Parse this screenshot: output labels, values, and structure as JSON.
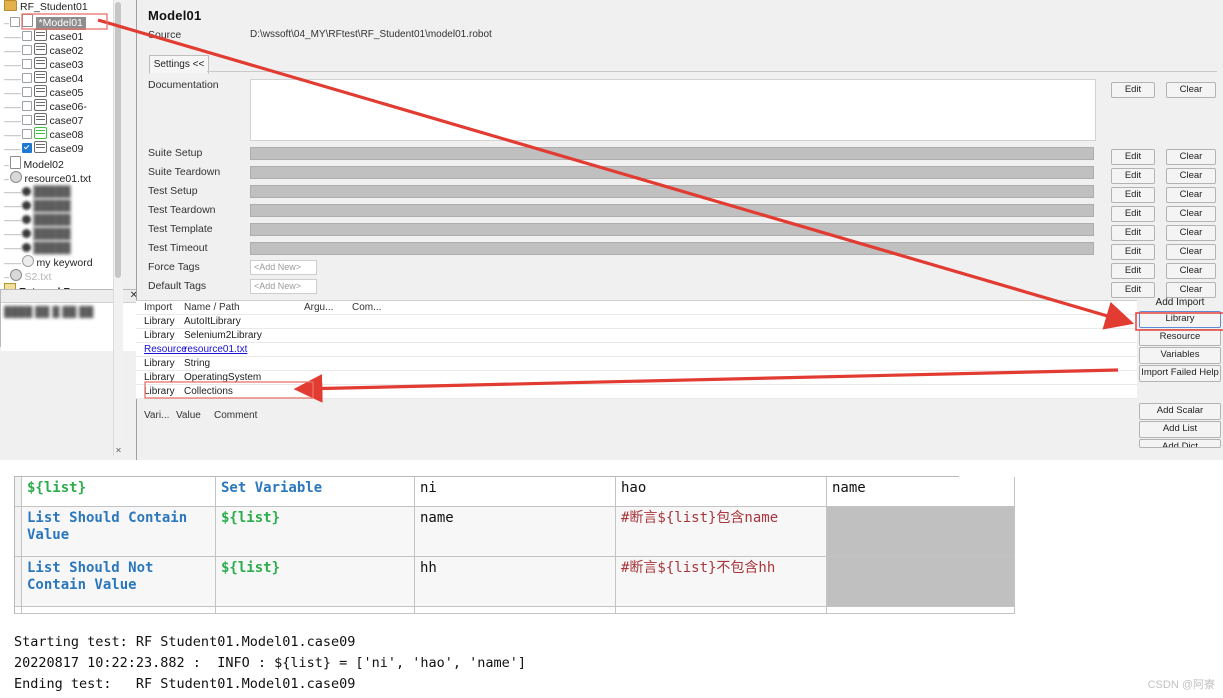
{
  "tree": {
    "items": [
      {
        "label": "RF_Student01",
        "icon": "folder-icon",
        "depth": 0,
        "state": "partial",
        "kind": "folder"
      },
      {
        "label": "*Model01",
        "icon": "file-icon",
        "depth": 1,
        "state": "unchecked",
        "kind": "selected"
      },
      {
        "label": "case01",
        "icon": "testcase-icon",
        "depth": 2,
        "state": "unchecked",
        "kind": "case"
      },
      {
        "label": "case02",
        "icon": "testcase-icon",
        "depth": 2,
        "state": "unchecked",
        "kind": "case"
      },
      {
        "label": "case03",
        "icon": "testcase-icon",
        "depth": 2,
        "state": "unchecked",
        "kind": "case"
      },
      {
        "label": "case04",
        "icon": "testcase-icon",
        "depth": 2,
        "state": "unchecked",
        "kind": "case"
      },
      {
        "label": "case05",
        "icon": "testcase-icon",
        "depth": 2,
        "state": "unchecked",
        "kind": "case"
      },
      {
        "label": "case06-",
        "icon": "testcase-icon",
        "depth": 2,
        "state": "unchecked",
        "kind": "case"
      },
      {
        "label": "case07",
        "icon": "testcase-icon",
        "depth": 2,
        "state": "unchecked",
        "kind": "case"
      },
      {
        "label": "case08",
        "icon": "testcase-icon-green",
        "depth": 2,
        "state": "unchecked",
        "kind": "case-green"
      },
      {
        "label": "case09",
        "icon": "testcase-icon",
        "depth": 2,
        "state": "checked",
        "kind": "case"
      },
      {
        "label": "Model02",
        "icon": "file-icon",
        "depth": 1,
        "state": "none",
        "kind": "file"
      },
      {
        "label": "resource01.txt",
        "icon": "resource-icon",
        "depth": 1,
        "state": "none",
        "kind": "resource"
      },
      {
        "label": "blurred-item-1",
        "icon": "keyword-icon",
        "depth": 2,
        "state": "none",
        "kind": "blur"
      },
      {
        "label": "blurred-item-2",
        "icon": "keyword-icon",
        "depth": 2,
        "state": "none",
        "kind": "blur"
      },
      {
        "label": "blurred-item-3",
        "icon": "keyword-icon",
        "depth": 2,
        "state": "none",
        "kind": "blur"
      },
      {
        "label": "blurred-item-4",
        "icon": "keyword-icon",
        "depth": 2,
        "state": "none",
        "kind": "blur"
      },
      {
        "label": "blurred-item-5",
        "icon": "keyword-icon",
        "depth": 2,
        "state": "none",
        "kind": "blur"
      },
      {
        "label": "my keyword",
        "icon": "keyword-icon",
        "depth": 2,
        "state": "none",
        "kind": "keyword"
      },
      {
        "label": "S2.txt",
        "icon": "resource-icon",
        "depth": 1,
        "state": "none",
        "kind": "faint"
      },
      {
        "label": "External Resources",
        "icon": "external-resources-icon",
        "depth": 0,
        "state": "none",
        "kind": "external"
      }
    ]
  },
  "editor": {
    "title": "Model01",
    "source_label": "Source",
    "source_value": "D:\\wssoft\\04_MY\\RFtest\\RF_Student01\\model01.robot",
    "settings_tab": "Settings <<",
    "settings_rows": [
      {
        "label": "Documentation",
        "type": "textarea",
        "value": "",
        "edit": "Edit",
        "clear": "Clear"
      },
      {
        "label": "Suite Setup",
        "type": "field",
        "value": "",
        "edit": "Edit",
        "clear": "Clear"
      },
      {
        "label": "Suite Teardown",
        "type": "field",
        "value": "",
        "edit": "Edit",
        "clear": "Clear"
      },
      {
        "label": "Test Setup",
        "type": "field",
        "value": "",
        "edit": "Edit",
        "clear": "Clear"
      },
      {
        "label": "Test Teardown",
        "type": "field",
        "value": "",
        "edit": "Edit",
        "clear": "Clear"
      },
      {
        "label": "Test Template",
        "type": "field",
        "value": "",
        "edit": "Edit",
        "clear": "Clear"
      },
      {
        "label": "Test Timeout",
        "type": "field",
        "value": "",
        "edit": "Edit",
        "clear": "Clear"
      },
      {
        "label": "Force Tags",
        "type": "tag",
        "value": "<Add New>",
        "edit": "Edit",
        "clear": "Clear"
      },
      {
        "label": "Default Tags",
        "type": "tag",
        "value": "<Add New>",
        "edit": "Edit",
        "clear": "Clear"
      }
    ]
  },
  "imports": {
    "headers": [
      "Import",
      "Name / Path",
      "Argu...",
      "Com..."
    ],
    "rows": [
      {
        "type": "Library",
        "name": "AutoItLibrary",
        "link": false,
        "highlight": false
      },
      {
        "type": "Library",
        "name": "Selenium2Library",
        "link": false,
        "highlight": false
      },
      {
        "type": "Resource",
        "name": "resource01.txt",
        "link": true,
        "highlight": false
      },
      {
        "type": "Library",
        "name": "String",
        "link": false,
        "highlight": false
      },
      {
        "type": "Library",
        "name": "OperatingSystem",
        "link": false,
        "highlight": false
      },
      {
        "type": "Library",
        "name": "Collections",
        "link": false,
        "highlight": true
      }
    ],
    "variables_headers": [
      "Vari...",
      "Value",
      "Comment"
    ]
  },
  "rail": {
    "add_import_title": "Add Import",
    "buttons": [
      "Library",
      "Resource",
      "Variables",
      "Import Failed Help"
    ],
    "variable_buttons": [
      "Add Scalar",
      "Add List",
      "Add Dict"
    ]
  },
  "grid": {
    "rows": [
      {
        "cells": [
          {
            "text": "${list}",
            "style": "var"
          },
          {
            "text": "Set Variable",
            "style": "kw"
          },
          {
            "text": "ni",
            "style": "plain"
          },
          {
            "text": "hao",
            "style": "plain"
          },
          {
            "text": "name",
            "style": "plain"
          }
        ],
        "kind": "head"
      },
      {
        "cells": [
          {
            "text": "List Should Contain Value",
            "style": "kw"
          },
          {
            "text": "${list}",
            "style": "var"
          },
          {
            "text": "name",
            "style": "plain"
          },
          {
            "text": "#断言${list}包含name",
            "style": "cmt"
          },
          {
            "text": "",
            "style": "grey"
          }
        ],
        "kind": "data"
      },
      {
        "cells": [
          {
            "text": "List Should Not Contain Value",
            "style": "kw"
          },
          {
            "text": "${list}",
            "style": "var"
          },
          {
            "text": "hh",
            "style": "plain"
          },
          {
            "text": "#断言${list}不包含hh",
            "style": "cmt"
          },
          {
            "text": "",
            "style": "grey"
          }
        ],
        "kind": "data"
      }
    ]
  },
  "console": {
    "lines": [
      "Starting test: RF Student01.Model01.case09",
      "20220817 10:22:23.882 :  INFO : ${list} = ['ni', 'hao', 'name']",
      "Ending test:   RF Student01.Model01.case09"
    ]
  },
  "watermark": "CSDN @阿寮",
  "colors": {
    "annotation_red": "#e23b32",
    "keyword_blue": "#2b77bd",
    "variable_green": "#2bad4c",
    "comment_red": "#a8363c",
    "link_blue": "#1a10d8",
    "focus_blue": "#5b8dd6",
    "selection_grey": "#8d8d8d"
  }
}
